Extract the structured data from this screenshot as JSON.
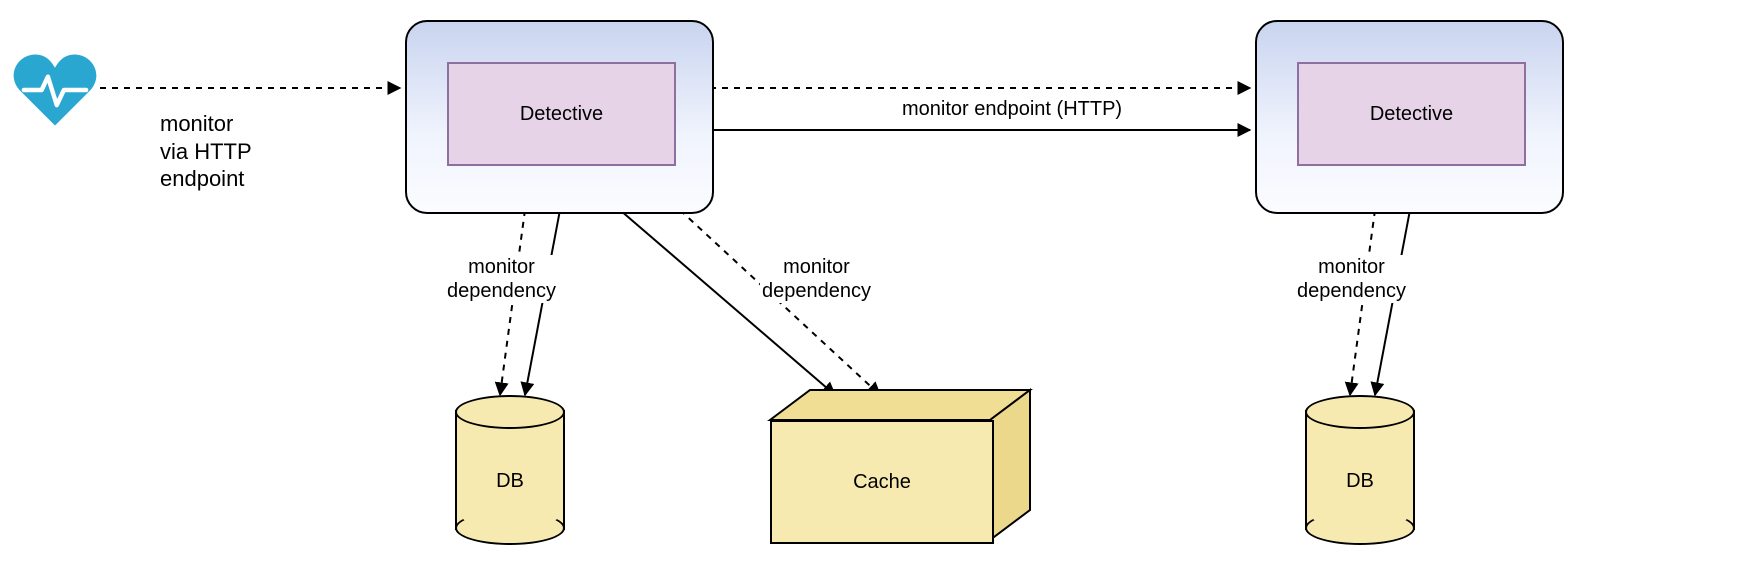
{
  "heart": {
    "name": "heartbeat-icon"
  },
  "labels": {
    "heart_to_svc": "monitor\nvia HTTP\nendpoint",
    "svc_to_svc": "monitor endpoint (HTTP)",
    "dep1": "monitor\ndependency",
    "dep2": "monitor\ndependency",
    "dep3": "monitor\ndependency"
  },
  "services": {
    "left": {
      "inner_label": "Detective"
    },
    "right": {
      "inner_label": "Detective"
    }
  },
  "db_left": {
    "label": "DB"
  },
  "db_right": {
    "label": "DB"
  },
  "cache": {
    "label": "Cache"
  }
}
